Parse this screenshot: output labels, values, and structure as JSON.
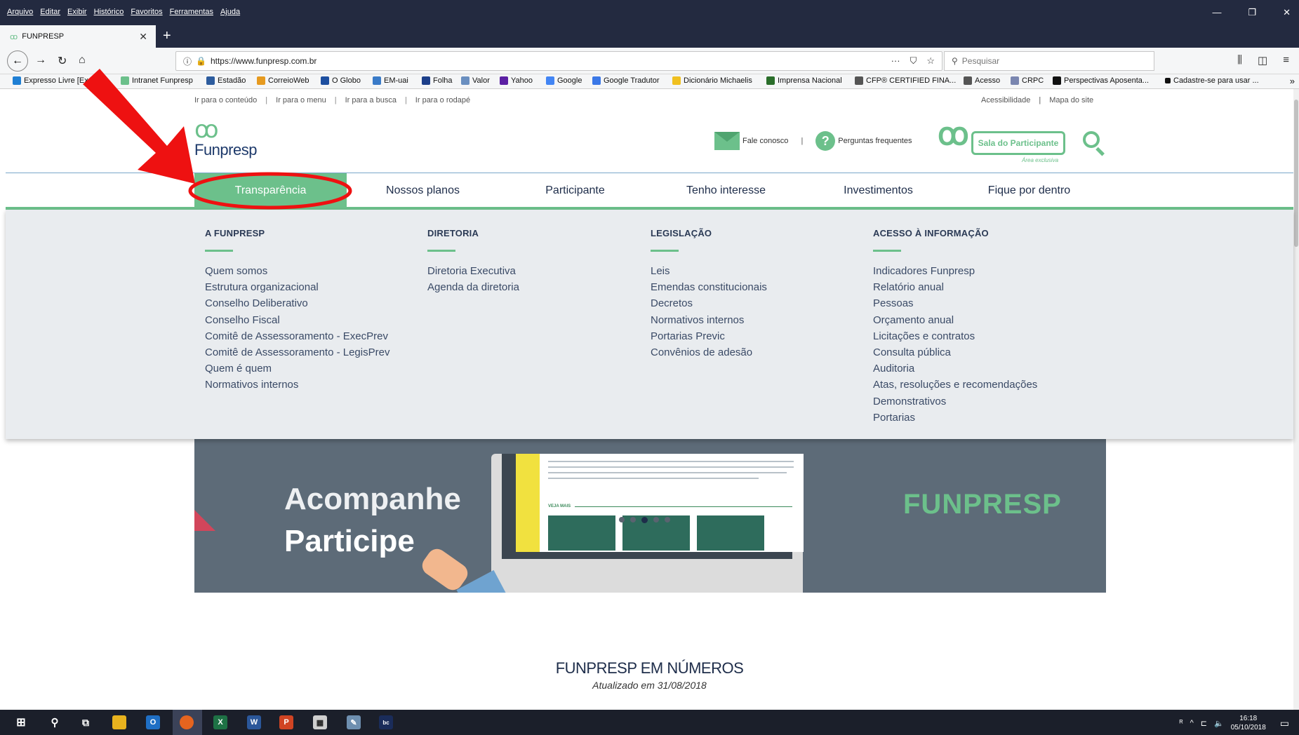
{
  "browser": {
    "menus": [
      "Arquivo",
      "Editar",
      "Exibir",
      "Histórico",
      "Favoritos",
      "Ferramentas",
      "Ajuda"
    ],
    "tab_title": "FUNPRESP",
    "url": "https://www.funpresp.com.br",
    "search_placeholder": "Pesquisar",
    "bookmarks": [
      "Expresso Livre [Expr...",
      "Intranet Funpresp",
      "Estadão",
      "CorreioWeb",
      "O Globo",
      "EM-uai",
      "Folha",
      "Valor",
      "Yahoo",
      "Google",
      "Google Tradutor",
      "Dicionário Michaelis",
      "Imprensa Nacional",
      "CFP® CERTIFIED FINA...",
      "Acesso",
      "CRPC",
      "Perspectivas Aposenta...",
      "Cadastre-se para usar ..."
    ]
  },
  "site": {
    "skip_links": [
      "Ir para o conteúdo",
      "Ir para o menu",
      "Ir para a busca",
      "Ir para o rodapé"
    ],
    "site_links": [
      "Acessibilidade",
      "Mapa do site"
    ],
    "logo_name": "Funpresp",
    "fale_conosco": "Fale conosco",
    "perguntas": "Perguntas frequentes",
    "sala_label": "Sala do Participante",
    "sala_sub": "Área exclusiva",
    "nav": [
      "Transparência",
      "Nossos planos",
      "Participante",
      "Tenho interesse",
      "Investimentos",
      "Fique por dentro"
    ],
    "mega": [
      {
        "title": "A FUNPRESP",
        "items": [
          "Quem somos",
          "Estrutura organizacional",
          "Conselho Deliberativo",
          "Conselho Fiscal",
          "Comitê de Assessoramento - ExecPrev",
          "Comitê de Assessoramento - LegisPrev",
          "Quem é quem",
          "Normativos internos"
        ]
      },
      {
        "title": "DIRETORIA",
        "items": [
          "Diretoria Executiva",
          "Agenda da diretoria"
        ]
      },
      {
        "title": "LEGISLAÇÃO",
        "items": [
          "Leis",
          "Emendas constitucionais",
          "Decretos",
          "Normativos internos",
          "Portarias Previc",
          "Convênios de adesão"
        ]
      },
      {
        "title": "ACESSO À INFORMAÇÃO",
        "items": [
          "Indicadores Funpresp",
          "Relatório anual",
          "Pessoas",
          "Orçamento anual",
          "Licitações e contratos",
          "Consulta pública",
          "Auditoria",
          "Atas, resoluções e recomendações",
          "Demonstrativos",
          "Portarias"
        ]
      }
    ],
    "banner": {
      "headline1": "Acompanhe",
      "headline2": "Participe",
      "brand": "FUNPRESP",
      "veja_mais": "VEJA MAIS"
    },
    "numbers_title": "FUNPRESP EM NÚMEROS",
    "numbers_sub": "Atualizado em 31/08/2018"
  },
  "taskbar": {
    "time": "16:18",
    "date": "05/10/2018"
  },
  "colors": {
    "accent_green": "#6cc08b",
    "navy": "#1e2d4a",
    "annotation_red": "#ee1111"
  }
}
